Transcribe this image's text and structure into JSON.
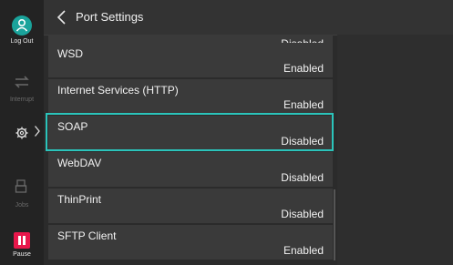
{
  "header": {
    "title": "Port Settings"
  },
  "rail": {
    "logout_label": "Log Out",
    "interrupt_label": "Interrupt",
    "jobs_label": "Jobs",
    "pause_label": "Pause"
  },
  "items": [
    {
      "name": "",
      "value": "Disabled"
    },
    {
      "name": "WSD",
      "value": "Enabled"
    },
    {
      "name": "Internet Services (HTTP)",
      "value": "Enabled"
    },
    {
      "name": "SOAP",
      "value": "Disabled"
    },
    {
      "name": "WebDAV",
      "value": "Disabled"
    },
    {
      "name": "ThinPrint",
      "value": "Disabled"
    },
    {
      "name": "SFTP Client",
      "value": "Enabled"
    }
  ],
  "selected_index": 3,
  "colors": {
    "accent": "#2bc4bb",
    "pause": "#e8174b",
    "logout": "#1aa39b"
  }
}
